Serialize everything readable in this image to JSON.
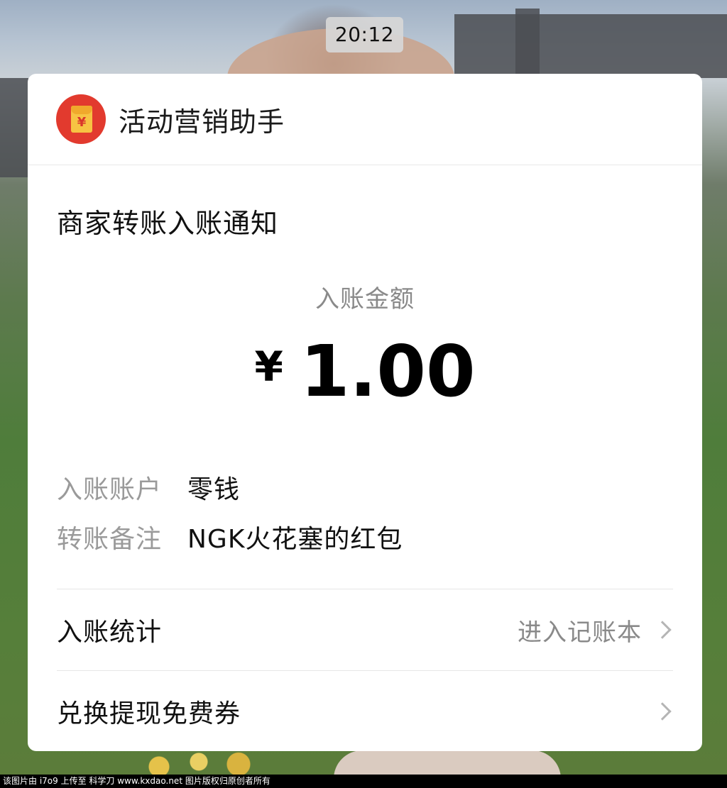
{
  "status_bar": {
    "time": "20:12"
  },
  "header": {
    "app_name": "活动营销助手",
    "icon_glyph": "¥",
    "icon": "red-envelope-icon"
  },
  "notice": {
    "title": "商家转账入账通知"
  },
  "amount": {
    "label": "入账金额",
    "currency": "¥",
    "value": "1.00"
  },
  "details": [
    {
      "label": "入账账户",
      "value": "零钱"
    },
    {
      "label": "转账备注",
      "value": "NGK火花塞的红包"
    }
  ],
  "actions": [
    {
      "label": "入账统计",
      "hint": "进入记账本"
    },
    {
      "label": "兑换提现免费券",
      "hint": ""
    }
  ],
  "watermark": "该图片由 i7o9 上传至 科学刀 www.kxdao.net 图片版权归原创者所有",
  "colors": {
    "icon_red": "#e23a2e",
    "icon_gold": "#f7c343",
    "muted_text": "#8a8a8a"
  }
}
